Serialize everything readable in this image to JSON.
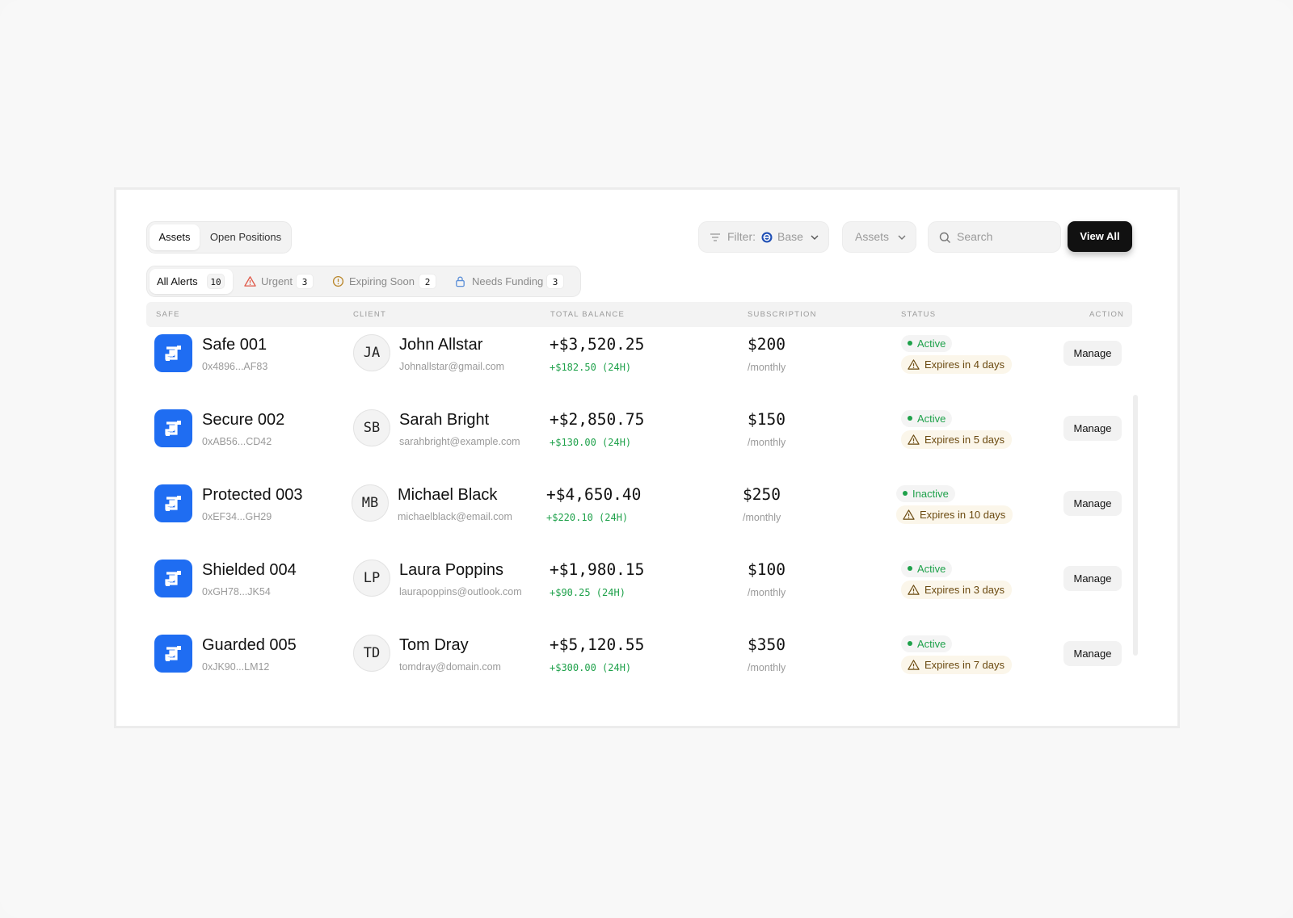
{
  "tabs": [
    "Assets",
    "Open Positions"
  ],
  "alerts": [
    {
      "label": "All Alerts",
      "count": "10"
    },
    {
      "label": "Urgent",
      "count": "3"
    },
    {
      "label": "Expiring Soon",
      "count": "2"
    },
    {
      "label": "Needs Funding",
      "count": "3"
    }
  ],
  "toolbar": {
    "filter_label": "Filter:",
    "filter_value": "Base",
    "assets_label": "Assets",
    "search_placeholder": "Search",
    "view_all": "View All"
  },
  "columns": [
    "Safe",
    "Client",
    "Total Balance",
    "Subscription",
    "Status",
    "Action"
  ],
  "colors": {
    "accent": "#1f6df2",
    "positive": "#1ea14a",
    "warning_text": "#6b4a10",
    "warning_bg": "#fbf6ea",
    "urgent": "#e05b4b",
    "expiring": "#b9862a",
    "funding": "#5b8fd8"
  },
  "rows": [
    {
      "safe": "Safe 001",
      "address": "0x4896...AF83",
      "initials": "JA",
      "client": "John Allstar",
      "email": "Johnallstar@gmail.com",
      "balance": "+$3,520.25",
      "delta": "+$182.50 (24H)",
      "price": "$200",
      "period": "/monthly",
      "status": "Active",
      "expires": "Expires in 4 days",
      "action": "Manage"
    },
    {
      "safe": "Secure 002",
      "address": "0xAB56...CD42",
      "initials": "SB",
      "client": "Sarah Bright",
      "email": "sarahbright@example.com",
      "balance": "+$2,850.75",
      "delta": "+$130.00 (24H)",
      "price": "$150",
      "period": "/monthly",
      "status": "Active",
      "expires": "Expires in 5 days",
      "action": "Manage"
    },
    {
      "safe": "Protected 003",
      "address": "0xEF34...GH29",
      "initials": "MB",
      "client": "Michael Black",
      "email": "michaelblack@email.com",
      "balance": "+$4,650.40",
      "delta": "+$220.10 (24H)",
      "price": "$250",
      "period": "/monthly",
      "status": "Inactive",
      "expires": "Expires in 10 days",
      "action": "Manage"
    },
    {
      "safe": "Shielded 004",
      "address": "0xGH78...JK54",
      "initials": "LP",
      "client": "Laura Poppins",
      "email": "laurapoppins@outlook.com",
      "balance": "+$1,980.15",
      "delta": "+$90.25 (24H)",
      "price": "$100",
      "period": "/monthly",
      "status": "Active",
      "expires": "Expires in 3 days",
      "action": "Manage"
    },
    {
      "safe": "Guarded 005",
      "address": "0xJK90...LM12",
      "initials": "TD",
      "client": "Tom Dray",
      "email": "tomdray@domain.com",
      "balance": "+$5,120.55",
      "delta": "+$300.00 (24H)",
      "price": "$350",
      "period": "/monthly",
      "status": "Active",
      "expires": "Expires in 7 days",
      "action": "Manage"
    }
  ]
}
